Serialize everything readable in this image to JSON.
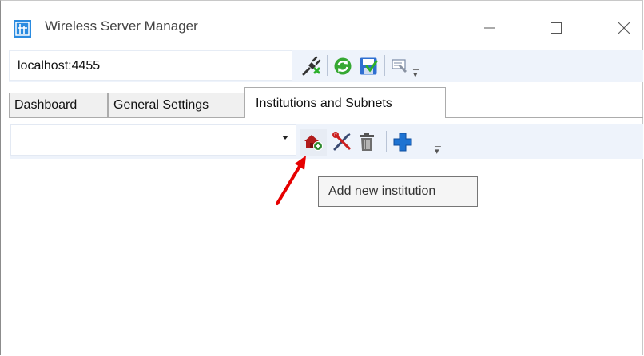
{
  "window": {
    "title": "Wireless Server Manager"
  },
  "icons": {
    "app": "app-icon",
    "minimize": "minimize-icon",
    "maximize": "maximize-icon",
    "close": "close-icon",
    "connect": "plug-icon",
    "refresh": "refresh-icon",
    "save": "save-icon",
    "tools": "tools-icon",
    "add_institution": "house-add-icon",
    "edit": "wrench-screwdriver-icon",
    "delete": "trash-icon",
    "add": "plus-icon"
  },
  "toolbar": {
    "server_address": "localhost:4455"
  },
  "tabs": [
    {
      "label": "Dashboard"
    },
    {
      "label": "General Settings"
    },
    {
      "label": "Institutions and Subnets"
    }
  ],
  "institutions": {
    "selected": ""
  },
  "tooltip": {
    "text": "Add new institution"
  },
  "colors": {
    "toolbar_bg": "#eef3fb",
    "annotation_arrow": "#e60000",
    "plus_blue": "#1e73d2",
    "house_red": "#b11b1b"
  }
}
